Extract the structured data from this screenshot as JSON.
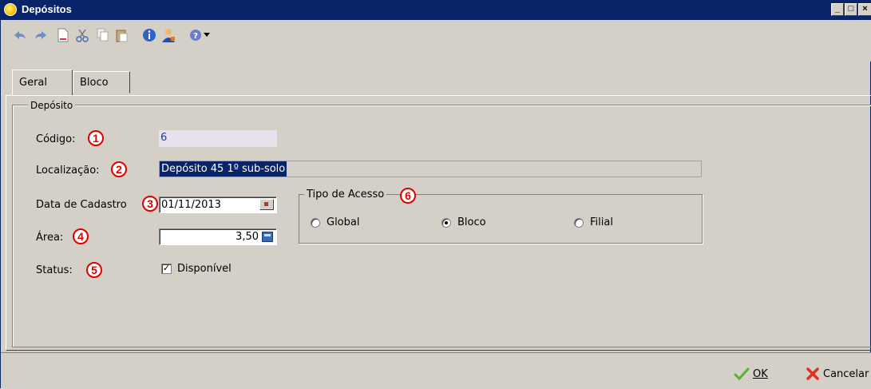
{
  "window": {
    "title": "Depósitos",
    "min": "_",
    "max": "□",
    "close": "×"
  },
  "toolbar": {
    "icons": [
      "undo-icon",
      "redo-icon",
      "new-document-icon",
      "cut-icon",
      "copy-icon",
      "paste-icon",
      "info-icon",
      "user-icon",
      "help-icon",
      "dropdown-arrow-icon"
    ]
  },
  "tabs": [
    {
      "label": "Geral"
    },
    {
      "label": "Bloco"
    }
  ],
  "group": {
    "title": "Depósito"
  },
  "form": {
    "codigo": {
      "label": "Código:",
      "value": "6",
      "marker": "1"
    },
    "localizacao": {
      "label": "Localização:",
      "value": "Depósito 45 1º sub-solo",
      "marker": "2"
    },
    "data": {
      "label": "Data de Cadastro",
      "value": "01/11/2013",
      "marker": "3"
    },
    "area": {
      "label": "Área:",
      "value": "3,50",
      "marker": "4"
    },
    "status": {
      "label": "Status:",
      "checkbox_label": "Disponível",
      "checked": true,
      "marker": "5"
    }
  },
  "tipo_acesso": {
    "title": "Tipo de Acesso",
    "marker": "6",
    "options": [
      {
        "label": "Global",
        "selected": false
      },
      {
        "label": "Bloco",
        "selected": true
      },
      {
        "label": "Filial",
        "selected": false
      }
    ]
  },
  "buttons": {
    "ok": "OK",
    "cancel": "Cancelar"
  },
  "colors": {
    "titlebar": "#0a246a",
    "marker": "#e00000",
    "face": "#d4d0c8"
  }
}
